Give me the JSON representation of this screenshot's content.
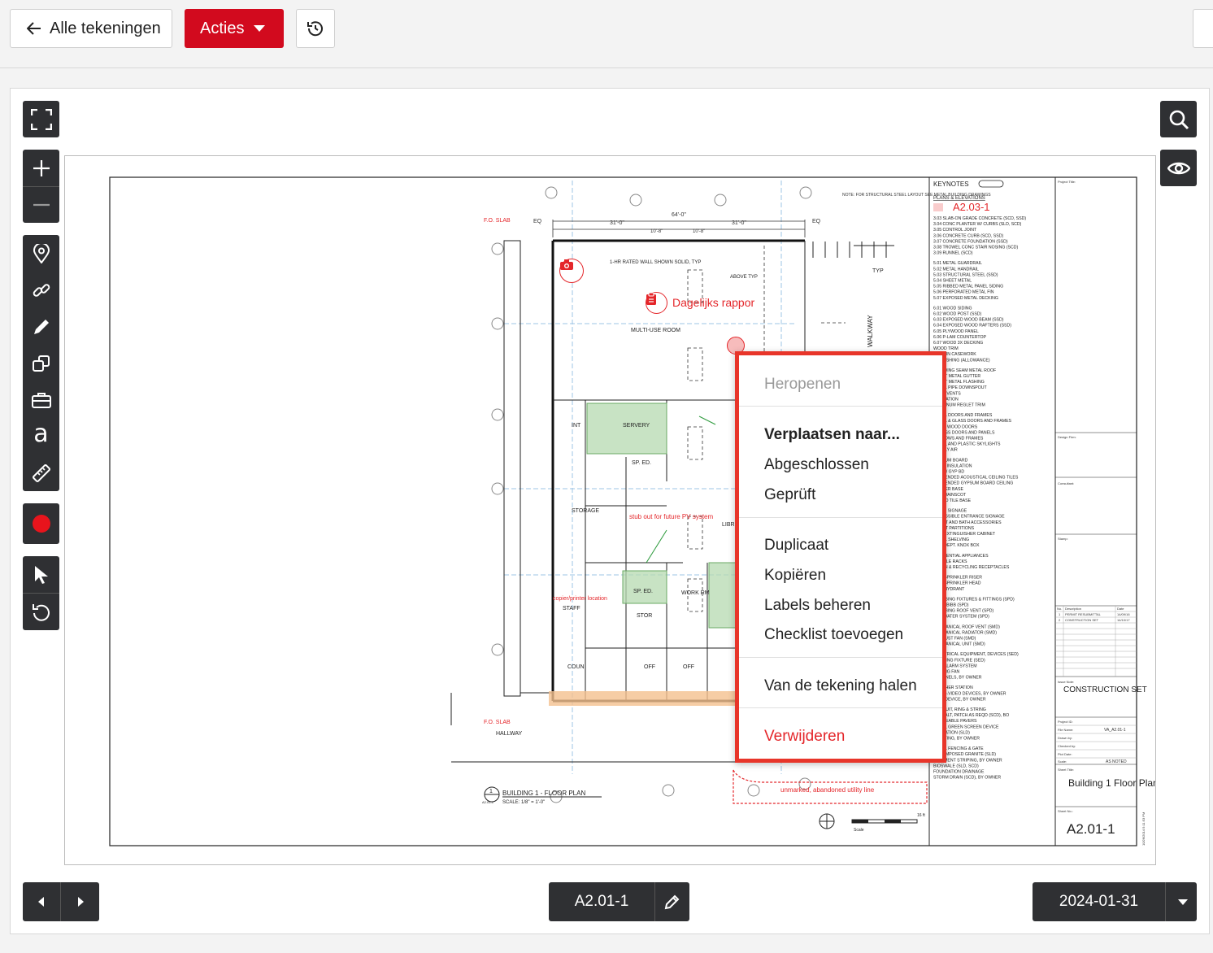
{
  "header": {
    "back_label": "Alle tekeningen",
    "actions_label": "Acties"
  },
  "viewer_tools": {
    "items": [
      "expand-icon",
      "zoom-in-icon",
      "zoom-out-icon",
      "location-pin-icon",
      "link-icon",
      "pen-icon",
      "copy-shapes-icon",
      "toolbox-icon",
      "text-icon",
      "ruler-icon",
      "record-icon",
      "pointer-icon",
      "undo-icon"
    ],
    "text_tool_glyph": "a",
    "record_color": "#e8141c"
  },
  "markups": {
    "daily_report": "Dagelijks rappor",
    "sheet_ref": "A2.03-1",
    "stub_note": "stub out for future PV system",
    "utility_note": "unmarked, abandoned utility line",
    "copier_note": "copier/printer location"
  },
  "drawing": {
    "room_multi_use": "MULTI-USE ROOM",
    "room_storage": "STORAGE",
    "room_server": "SERVERY",
    "room_sped": "SP. ED.",
    "room_work": "WORK RM",
    "room_staff": "STAFF",
    "room_coun": "COUN",
    "room_hallway": "HALLWAY",
    "room_int": "INT",
    "room_stor": "STOR",
    "room_off": "OFF",
    "room_libr": "LIBR",
    "walkway": "WALKWAY",
    "rated_wall": "1-HR RATED WALL SHOWN SOLID, TYP",
    "plan_title": "BUILDING 1 - FLOOR PLAN",
    "plan_scale": "SCALE: 1/8\" = 1'-0\"",
    "plan_ref_num": "1",
    "plan_ref_sheet": "A2.01-1",
    "fo_slab": "F.O. SLAB",
    "dim_64": "64'-0\"",
    "dim_31a": "31'-0\"",
    "dim_31b": "31'-0\"",
    "dim_10a": "10'-8\"",
    "dim_10b": "10'-8\"",
    "eq_a": "EQ",
    "eq_b": "EQ",
    "note_top": "NOTE: FOR STRUCTURAL STEEL LAYOUT SEE METAL BUILDING DRAWINGS",
    "keynotes_title": "KEYNOTES",
    "keynotes_subtitle": "PLANS & ELEVATIONS",
    "keynotes": [
      "3.03 SLAB-ON GRADE CONCRETE (SCD, SSD)",
      "3.04 CONC PLANTER W/ CURBS (SLD, SCD)",
      "3.05 CONTROL JOINT",
      "3.06 CONCRETE CURB (SCD, SSD)",
      "3.07 CONCRETE FOUNDATION (SSD)",
      "3.08 TROWEL CONC STAIR NOSING (SCD)",
      "3.09 RUNNEL (SCD)",
      "5.01 METAL GUARDRAIL",
      "5.02 METAL HANDRAIL",
      "5.03 STRUCTURAL STEEL (SSD)",
      "5.04 SHEET METAL",
      "5.05 RIBBED METAL PANEL SIDING",
      "5.06 PERFORATED METAL FIN",
      "5.07 EXPOSED METAL DECKING",
      "6.01 WOOD SIDING",
      "6.02 WOOD POST (SSD)",
      "6.03 EXPOSED WOOD BEAM (SSD)",
      "6.04 EXPOSED WOOD RAFTERS (SSD)",
      "6.05 PLYWOOD PANEL",
      "6.06 P-LAM COUNTERTOP",
      "6.07 WOOD 3X DECKING",
      "WOOD TRIM",
      "BUILT-IN CASEWORK",
      "FURNISHING (ALLOWANCE)",
      "STANDING SEAM METAL ROOF",
      "SHEET METAL GUTTER",
      "SHEET METAL FLASHING",
      "METAL PIPE DOWNSPOUT",
      "ROOF VENTS",
      "INSULATION",
      "ALUMINUM REGLET TRIM",
      "METAL DOORS AND FRAMES",
      "METAL & GLASS DOORS AND FRAMES",
      "SOLID WOOD DOORS",
      "ACCESS DOORS AND PANELS",
      "WINDOWS AND FRAMES",
      "METAL AND PLASTIC SKYLIGHTS",
      "SUPPLY AIR",
      "GYPSUM BOARD",
      "LINED INSULATION",
      "FRP O/ GYP BD",
      "SUSPENDED ACOUSTICAL CEILING TILES",
      "SUSPENDED GYPSUM BOARD CEILING",
      "RUBBER BASE",
      "TILE WAINSCOT",
      "COVED TILE BASE",
      "ROOM SIGNAGE",
      "ACCESSIBLE ENTRANCE SIGNAGE",
      "TOILET AND BATH ACCESSORIES",
      "TOILET PARTITIONS",
      "FIRE EXTINGUISHER CABINET",
      "METAL SHELVING",
      "FIRE DEPT. KNOX BOX",
      "RESIDENTIAL APPLIANCES",
      "BICYCLE RACKS",
      "TRASH & RECYCLING RECEPTACLES",
      "FIRE SPRINKLER RISER",
      "FIRE SPRINKLER HEAD",
      "FIRE HYDRANT",
      "PLUMBING FIXTURES & FITTINGS (SPD)",
      "HOSE BIBB (SPD)",
      "PLUMBING ROOF VENT (SPD)",
      "RAINWATER SYSTEM (SPD)",
      "MECHANICAL ROOF VENT (SMD)",
      "MECHANICAL RADIATOR (SMD)",
      "EXHAUST FAN (SMD)",
      "MECHANICAL UNIT (SMD)",
      "ELECTRICAL EQUIPMENT, DEVICES (SED)",
      "LIGHTING FIXTURE (SED)",
      "FIRE ALARM SYSTEM",
      "CEILING FAN",
      "PV PANELS, BY OWNER",
      "WEATHER STATION",
      "AUDIO-VIDEO DEVICES, BY OWNER",
      "DATA DEVICE, BY OWNER",
      "CONDUIT, RING & STRING",
      "ASPHALT, PATCH AS REQD (SCD), BO",
      "PERMEABLE PAVERS",
      "METAL GREEN SCREEN DEVICE",
      "IRRIGATION (SLD)",
      "PLANTING, BY OWNER",
      "METAL FENCING & GATE",
      "DECOMPOSED GRANITE (SLD)",
      "PAVEMENT STRIPING, BY OWNER",
      "BIOSWALE (SLD, SCD)",
      "FOUNDATION DRAINAGE",
      "STORM DRAIN (SCD), BY OWNER"
    ],
    "tb_project_title": "Project Title:",
    "tb_design_firm": "Design Firm:",
    "tb_consultant": "Consultant:",
    "tb_stamp": "Stamp:",
    "tb_rev_header": [
      "No.",
      "Description",
      "Date"
    ],
    "tb_revs": [
      [
        "1",
        "PERMIT RESUBMITTAL",
        "14/09/16"
      ],
      [
        "2",
        "CONSTRUCTION SET",
        "14/10/17"
      ]
    ],
    "tb_issue_label": "Issue Note:",
    "tb_issue": "CONSTRUCTION SET",
    "tb_project_id": "Project ID:",
    "tb_file_name": "File Name:",
    "tb_file_value": "VA_A2.01-1",
    "tb_drawn": "Drawn by:",
    "tb_checked": "Checked by:",
    "tb_plot": "Plot Date:",
    "tb_scale": "Scale:",
    "tb_scale_value": "AS NOTED",
    "tb_sheet_title_label": "Sheet Title:",
    "tb_sheet_title": "Building 1 Floor Plan",
    "tb_sheet_no_label": "Sheet No.:",
    "tb_sheet_no": "A2.01-1",
    "tb_plot_stamp": "10/26/2014 5:11:53 PM",
    "scale_label": "Scale",
    "scale_end": "16 ft",
    "typ": "TYP",
    "above": "ABOVE TYP"
  },
  "context_menu": {
    "reopen": "Heropenen",
    "move_to": "Verplaatsen naar...",
    "closed": "Abgeschlossen",
    "checked": "Geprüft",
    "duplicate": "Duplicaat",
    "copy": "Kopiëren",
    "manage_labels": "Labels beheren",
    "add_checklist": "Checklist toevoegen",
    "remove_from_drawing": "Van de tekening halen",
    "delete": "Verwijderen",
    "delete_color": "#e4262a"
  },
  "footer": {
    "sheet_number": "A2.01-1",
    "date": "2024-01-31"
  }
}
